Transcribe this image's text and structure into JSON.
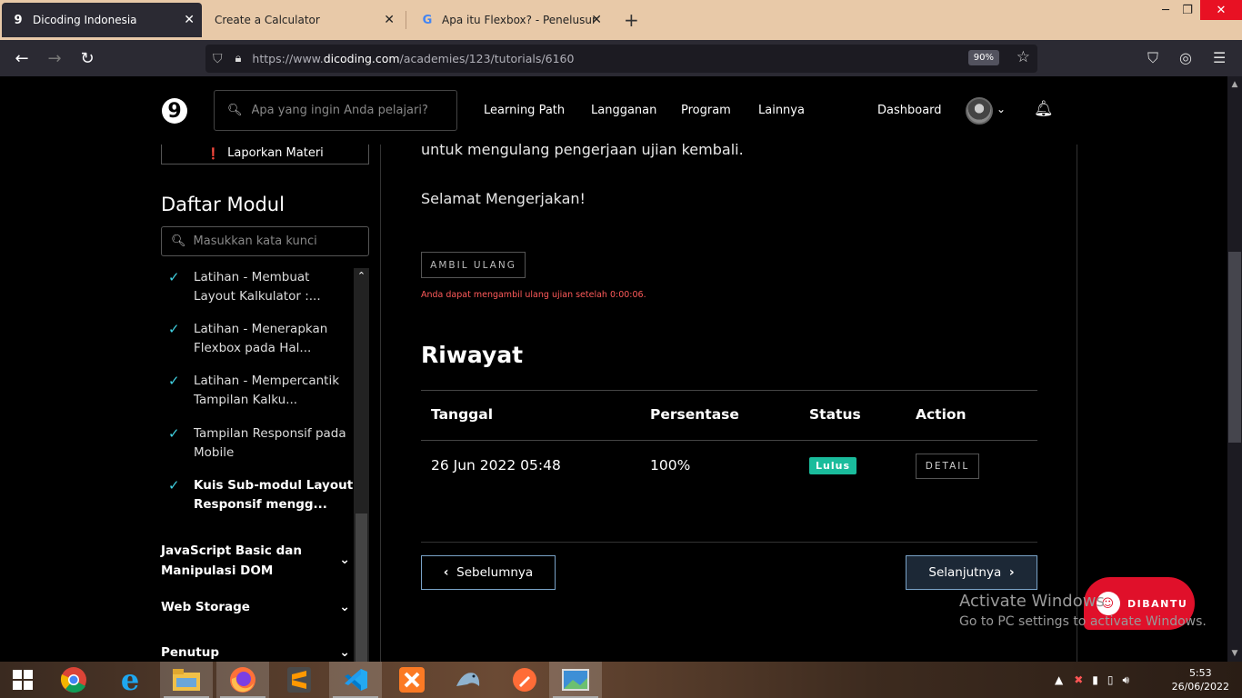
{
  "browser": {
    "tabs": [
      {
        "title": "Dicoding Indonesia",
        "favicon": "9"
      },
      {
        "title": "Create a Calculator",
        "favicon": ""
      },
      {
        "title": "Apa itu Flexbox? - Penelusuran G",
        "favicon": "G"
      }
    ],
    "url_prefix": "https://www.",
    "url_host": "dicoding.com",
    "url_path": "/academies/123/tutorials/6160",
    "zoom": "90%"
  },
  "header": {
    "logo": "9",
    "search_placeholder": "Apa yang ingin Anda pelajari?",
    "menu": [
      "Learning Path",
      "Langganan",
      "Program",
      "Lainnya"
    ],
    "dashboard": "Dashboard"
  },
  "sidebar": {
    "report": "Laporkan Materi",
    "title": "Daftar Modul",
    "search_placeholder": "Masukkan kata kunci",
    "items": [
      {
        "label": "Latihan - Membuat Layout Kalkulator :..."
      },
      {
        "label": "Latihan - Menerapkan Flexbox pada Hal..."
      },
      {
        "label": "Latihan - Mempercantik Tampilan Kalku..."
      },
      {
        "label": "Tampilan Responsif pada Mobile"
      },
      {
        "label": "Kuis Sub-modul Layout Responsif mengg..."
      }
    ],
    "sections": [
      "JavaScript Basic dan Manipulasi DOM",
      "Web Storage",
      "Penutup"
    ]
  },
  "main": {
    "intro_tail": "untuk mengulang pengerjaan ujian kembali.",
    "greeting": "Selamat Mengerjakan!",
    "retry_button": "AMBIL ULANG",
    "retry_note": "Anda dapat mengambil ulang ujian setelah 0:00:06.",
    "history_title": "Riwayat",
    "table": {
      "headers": [
        "Tanggal",
        "Persentase",
        "Status",
        "Action"
      ],
      "rows": [
        {
          "date": "26 Jun 2022 05:48",
          "percent": "100%",
          "status": "Lulus",
          "action": "DETAIL"
        }
      ]
    },
    "prev_button": "Sebelumnya",
    "next_button": "Selanjutnya"
  },
  "overlay": {
    "activate_title": "Activate Windows",
    "activate_sub": "Go to PC settings to activate Windows.",
    "dibantu": "DIBANTU"
  },
  "taskbar": {
    "time": "5:53",
    "date": "26/06/2022"
  },
  "colors": {
    "accent_check": "#40d0e0",
    "status_green": "#1abc9c",
    "warning_red": "#ff5a5a",
    "firefox_tab_bar": "#e8c9a8"
  }
}
